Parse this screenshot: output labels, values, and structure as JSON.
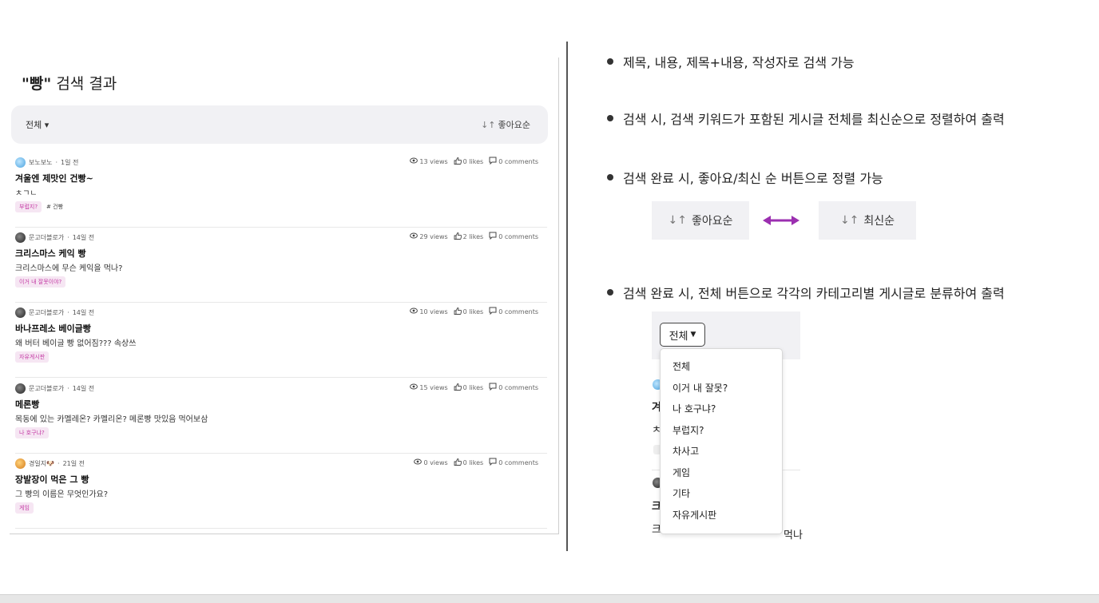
{
  "left": {
    "search_keyword": "\"빵\"",
    "search_suffix": " 검색 결과",
    "filter_label": "전체",
    "sort_label": "좋아요순",
    "posts": [
      {
        "author": "보노보노",
        "time": "1일 전",
        "title": "겨울엔 제맛인 건빵~",
        "body": "ㅊㄱㄴ",
        "tag": "부럽지?",
        "hashtag": "# 건빵",
        "views": "13 views",
        "likes": "0 likes",
        "comments": "0 comments",
        "avatar": "blue"
      },
      {
        "author": "문고더블로가",
        "time": "14일 전",
        "title": "크리스마스 케익 빵",
        "body": "크리스마스에 무슨 케익을 먹나?",
        "tag": "이거 내 잘못이야?",
        "hashtag": "",
        "views": "29 views",
        "likes": "2 likes",
        "comments": "0 comments",
        "avatar": "dark"
      },
      {
        "author": "문고더블로가",
        "time": "14일 전",
        "title": "바나프레소 베이글빵",
        "body": "왜 버터 베이글 빵 없어짐??? 속상쓰",
        "tag": "자유게시판",
        "hashtag": "",
        "views": "10 views",
        "likes": "0 likes",
        "comments": "0 comments",
        "avatar": "dark"
      },
      {
        "author": "문고더블로가",
        "time": "14일 전",
        "title": "메론빵",
        "body": "목동에 있는 카멜레온? 카멜리온? 메론빵 맛있음 먹어보삼",
        "tag": "나 호구냐?",
        "hashtag": "",
        "views": "15 views",
        "likes": "0 likes",
        "comments": "0 comments",
        "avatar": "dark"
      },
      {
        "author": "경일지🐶",
        "time": "21일 전",
        "title": "장발장이 먹은 그 빵",
        "body": "그 빵의 이름은 무엇인가요?",
        "tag": "게임",
        "hashtag": "",
        "views": "0 views",
        "likes": "0 likes",
        "comments": "0 comments",
        "avatar": "orange"
      }
    ]
  },
  "right": {
    "bullets": [
      "제목, 내용, 제목+내용, 작성자로 검색 가능",
      "검색 시, 검색 키워드가 포함된 게시글 전체를 최신순으로 정렬하여 출력",
      "검색 완료 시, 좋아요/최신 순 버튼으로 정렬 가능",
      "검색 완료 시, 전체 버튼으로 각각의 카테고리별 게시글로 분류하여 출력"
    ],
    "sort_like": "좋아요순",
    "sort_new": "최신순",
    "dropdown_label": "전체",
    "dropdown_items": [
      "전체",
      "이거 내 잘못?",
      "나 호구냐?",
      "부럽지?",
      "차사고",
      "게임",
      "기타",
      "자유게시판"
    ],
    "bg_fragments": {
      "a": "겨",
      "b": "ㅊ",
      "c": "크",
      "d": "크",
      "e": "먹나"
    }
  },
  "colors": {
    "tag_text": "#c43aa4",
    "tag_bg": "#f6e6f3",
    "arrow": "#9b2fb0",
    "panel_bg": "#f1f1f4"
  }
}
